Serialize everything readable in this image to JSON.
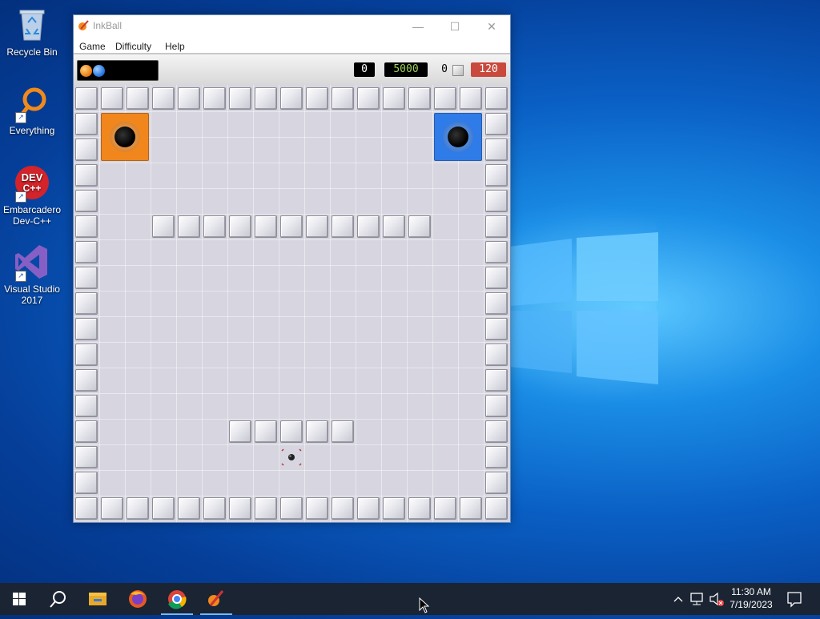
{
  "desktop": {
    "icons": [
      {
        "label": "Recycle Bin",
        "icon": "recycle-bin-icon"
      },
      {
        "label": "Everything",
        "icon": "everything-search-icon"
      },
      {
        "label": "Embarcadero Dev-C++",
        "icon": "devcpp-icon",
        "badge": "DEV C++"
      },
      {
        "label": "Visual Studio 2017",
        "icon": "visual-studio-icon"
      }
    ]
  },
  "window": {
    "title": "InkBall",
    "menu": [
      "Game",
      "Difficulty",
      "Help"
    ],
    "toolbar": {
      "score": "0",
      "target_score": "5000",
      "walls_drawn": "0",
      "time": "120"
    },
    "board": {
      "holes": [
        {
          "color": "orange",
          "hex": "#f0861c"
        },
        {
          "color": "blue",
          "hex": "#2f7be8"
        }
      ]
    }
  },
  "colors": {
    "accent": "#76b9ed",
    "time_badge": "#c94a3c",
    "score_text": "#9ed35a"
  },
  "taskbar": {
    "apps": [
      "start-icon",
      "search-icon",
      "file-explorer-icon",
      "firefox-icon",
      "chrome-icon",
      "inkball-icon"
    ],
    "clock_time": "11:30 AM",
    "clock_date": "7/19/2023"
  }
}
